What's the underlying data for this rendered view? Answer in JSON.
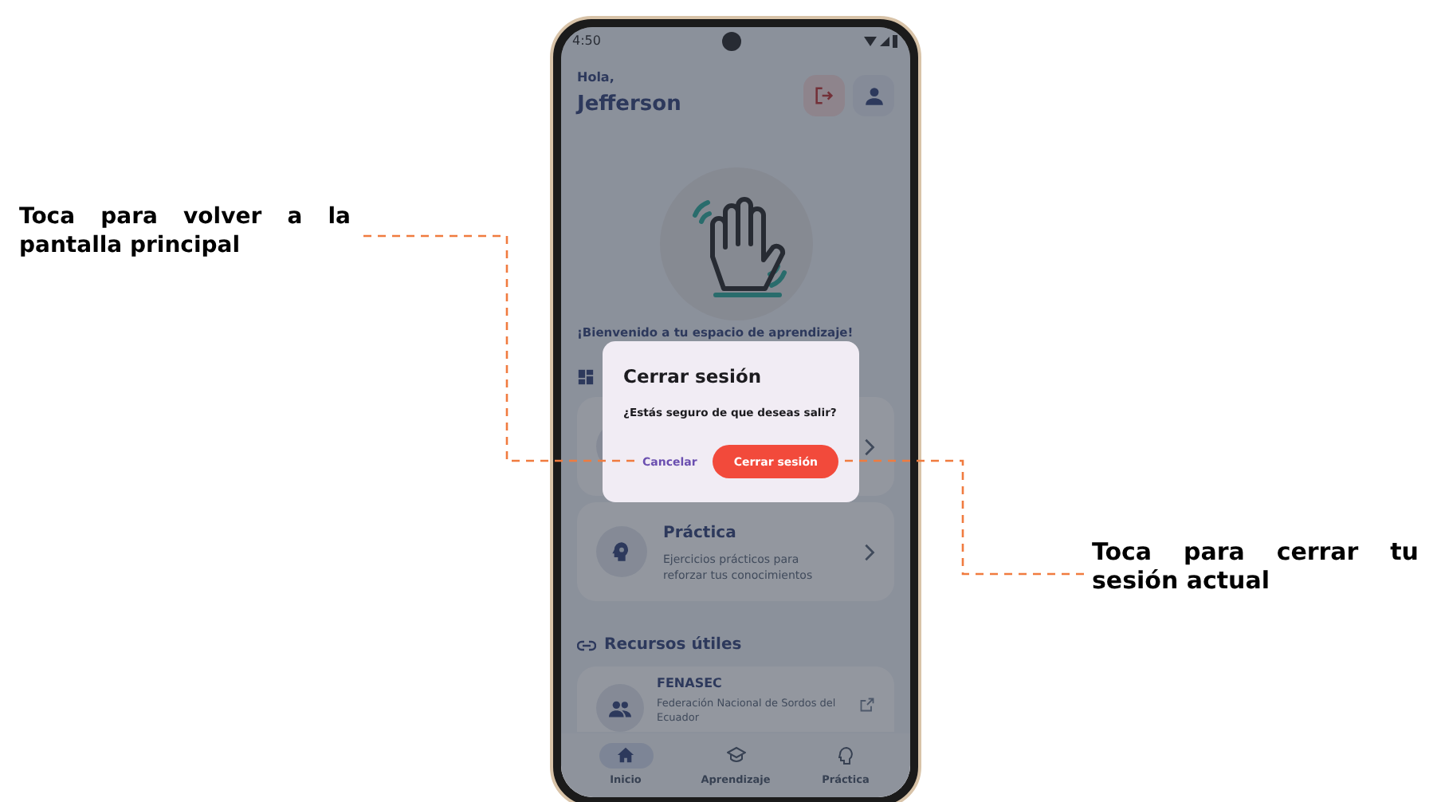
{
  "annotations": [
    {
      "text": "Toca para volver a la pantalla principal"
    },
    {
      "text": "Toca para cerrar tu sesión actual"
    }
  ],
  "status_bar": {
    "time": "4:50"
  },
  "header": {
    "greeting": "Hola,",
    "name": "Jefferson"
  },
  "welcome": "¡Bienvenido a tu espacio de aprendizaje!",
  "cards": [
    {
      "kind": "hidden"
    },
    {
      "kind": "visible",
      "title": "Práctica",
      "description": "Ejercicios prácticos para reforzar tus conocimientos"
    }
  ],
  "resources": {
    "title": "Recursos útiles",
    "items": [
      {
        "title": "FENASEC",
        "description": "Federación Nacional de Sordos del Ecuador"
      }
    ]
  },
  "bottom_nav": [
    {
      "label": "Inicio",
      "selected": true
    },
    {
      "label": "Aprendizaje",
      "selected": false
    },
    {
      "label": "Práctica",
      "selected": false
    }
  ],
  "dialog": {
    "title": "Cerrar sesión",
    "message": "¿Estás seguro de que deseas salir?",
    "buttons": [
      {
        "label": "Cancelar",
        "kind": "text"
      },
      {
        "label": "Cerrar sesión",
        "kind": "filled"
      }
    ]
  }
}
